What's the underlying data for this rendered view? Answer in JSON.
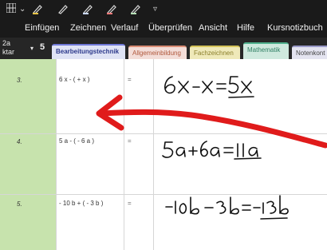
{
  "toolbar": {
    "icons": [
      "grid-menu-icon",
      "pen-icon",
      "pen-icon",
      "pen-icon",
      "pen-icon",
      "pen-icon",
      "dropdown-icon"
    ],
    "grid_chevron": "⌄",
    "dropdown_glyph": "▿",
    "pen_colors": [
      "#e8c547",
      "#d8d8d8",
      "#c9d8ff",
      "#ff7a7a",
      "#b6e0b6"
    ]
  },
  "menu": {
    "items": [
      "Einfügen",
      "Zeichnen",
      "Verlauf",
      "Überprüfen",
      "Ansicht",
      "Hilfe",
      "Kursnotizbuch"
    ]
  },
  "notebook": {
    "name_line1": "2a",
    "name_line2": "ktar",
    "caret": "▾",
    "number": "5"
  },
  "tabs": [
    {
      "label": "Bearbeitungstechnik",
      "color": "#6f78d6"
    },
    {
      "label": "Allgemeinbildung",
      "color": "#d98c74"
    },
    {
      "label": "Fachzeichnen",
      "color": "#d4c35a"
    },
    {
      "label": "Mathematik",
      "color": "#4fb08c"
    },
    {
      "label": "Notenkont",
      "color": "#9a9ac8"
    }
  ],
  "rows": [
    {
      "num": "3.",
      "expr": "6 x - ( + x )",
      "eq": "=",
      "handwritten": "6x−x=5x"
    },
    {
      "num": "4.",
      "expr": "5 a - ( - 6 a )",
      "eq": "=",
      "handwritten": "5a+6a=11a"
    },
    {
      "num": "5.",
      "expr": "- 10 b + ( - 3 b )",
      "eq": "=",
      "handwritten": "−10b−3b=−13b"
    }
  ],
  "annotation": {
    "arrow_color": "#e01b1b",
    "ink_color": "#111111"
  }
}
